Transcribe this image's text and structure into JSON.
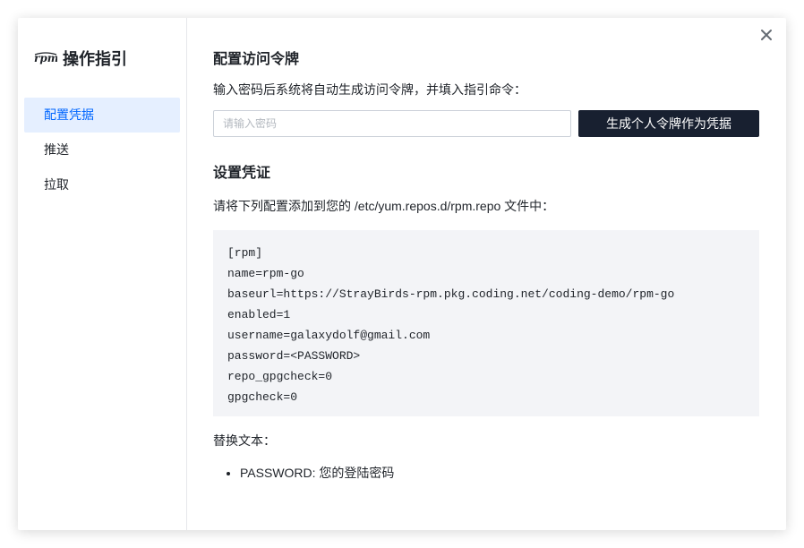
{
  "sidebar": {
    "brand_title": "操作指引",
    "logo_icon": "rpm-logo",
    "items": [
      {
        "label": "配置凭据",
        "active": true
      },
      {
        "label": "推送",
        "active": false
      },
      {
        "label": "拉取",
        "active": false
      }
    ]
  },
  "main": {
    "close_icon": "close-icon",
    "section1_title": "配置访问令牌",
    "section1_desc": "输入密码后系统将自动生成访问令牌，并填入指引命令：",
    "password_placeholder": "请输入密码",
    "generate_button": "生成个人令牌作为凭据",
    "section2_title": "设置凭证",
    "section2_desc": "请将下列配置添加到您的 /etc/yum.repos.d/rpm.repo 文件中：",
    "code_lines": [
      "[rpm]",
      "name=rpm-go",
      "baseurl=https://StrayBirds-rpm.pkg.coding.net/coding-demo/rpm-go",
      "enabled=1",
      "username=galaxydolf@gmail.com",
      "password=<PASSWORD>",
      "repo_gpgcheck=0",
      "gpgcheck=0"
    ],
    "replace_label": "替换文本：",
    "replacements": [
      "PASSWORD: 您的登陆密码"
    ]
  },
  "colors": {
    "accent": "#0066ff",
    "active_bg": "#e5efff",
    "button_bg": "#182030",
    "code_bg": "#f3f4f7"
  }
}
